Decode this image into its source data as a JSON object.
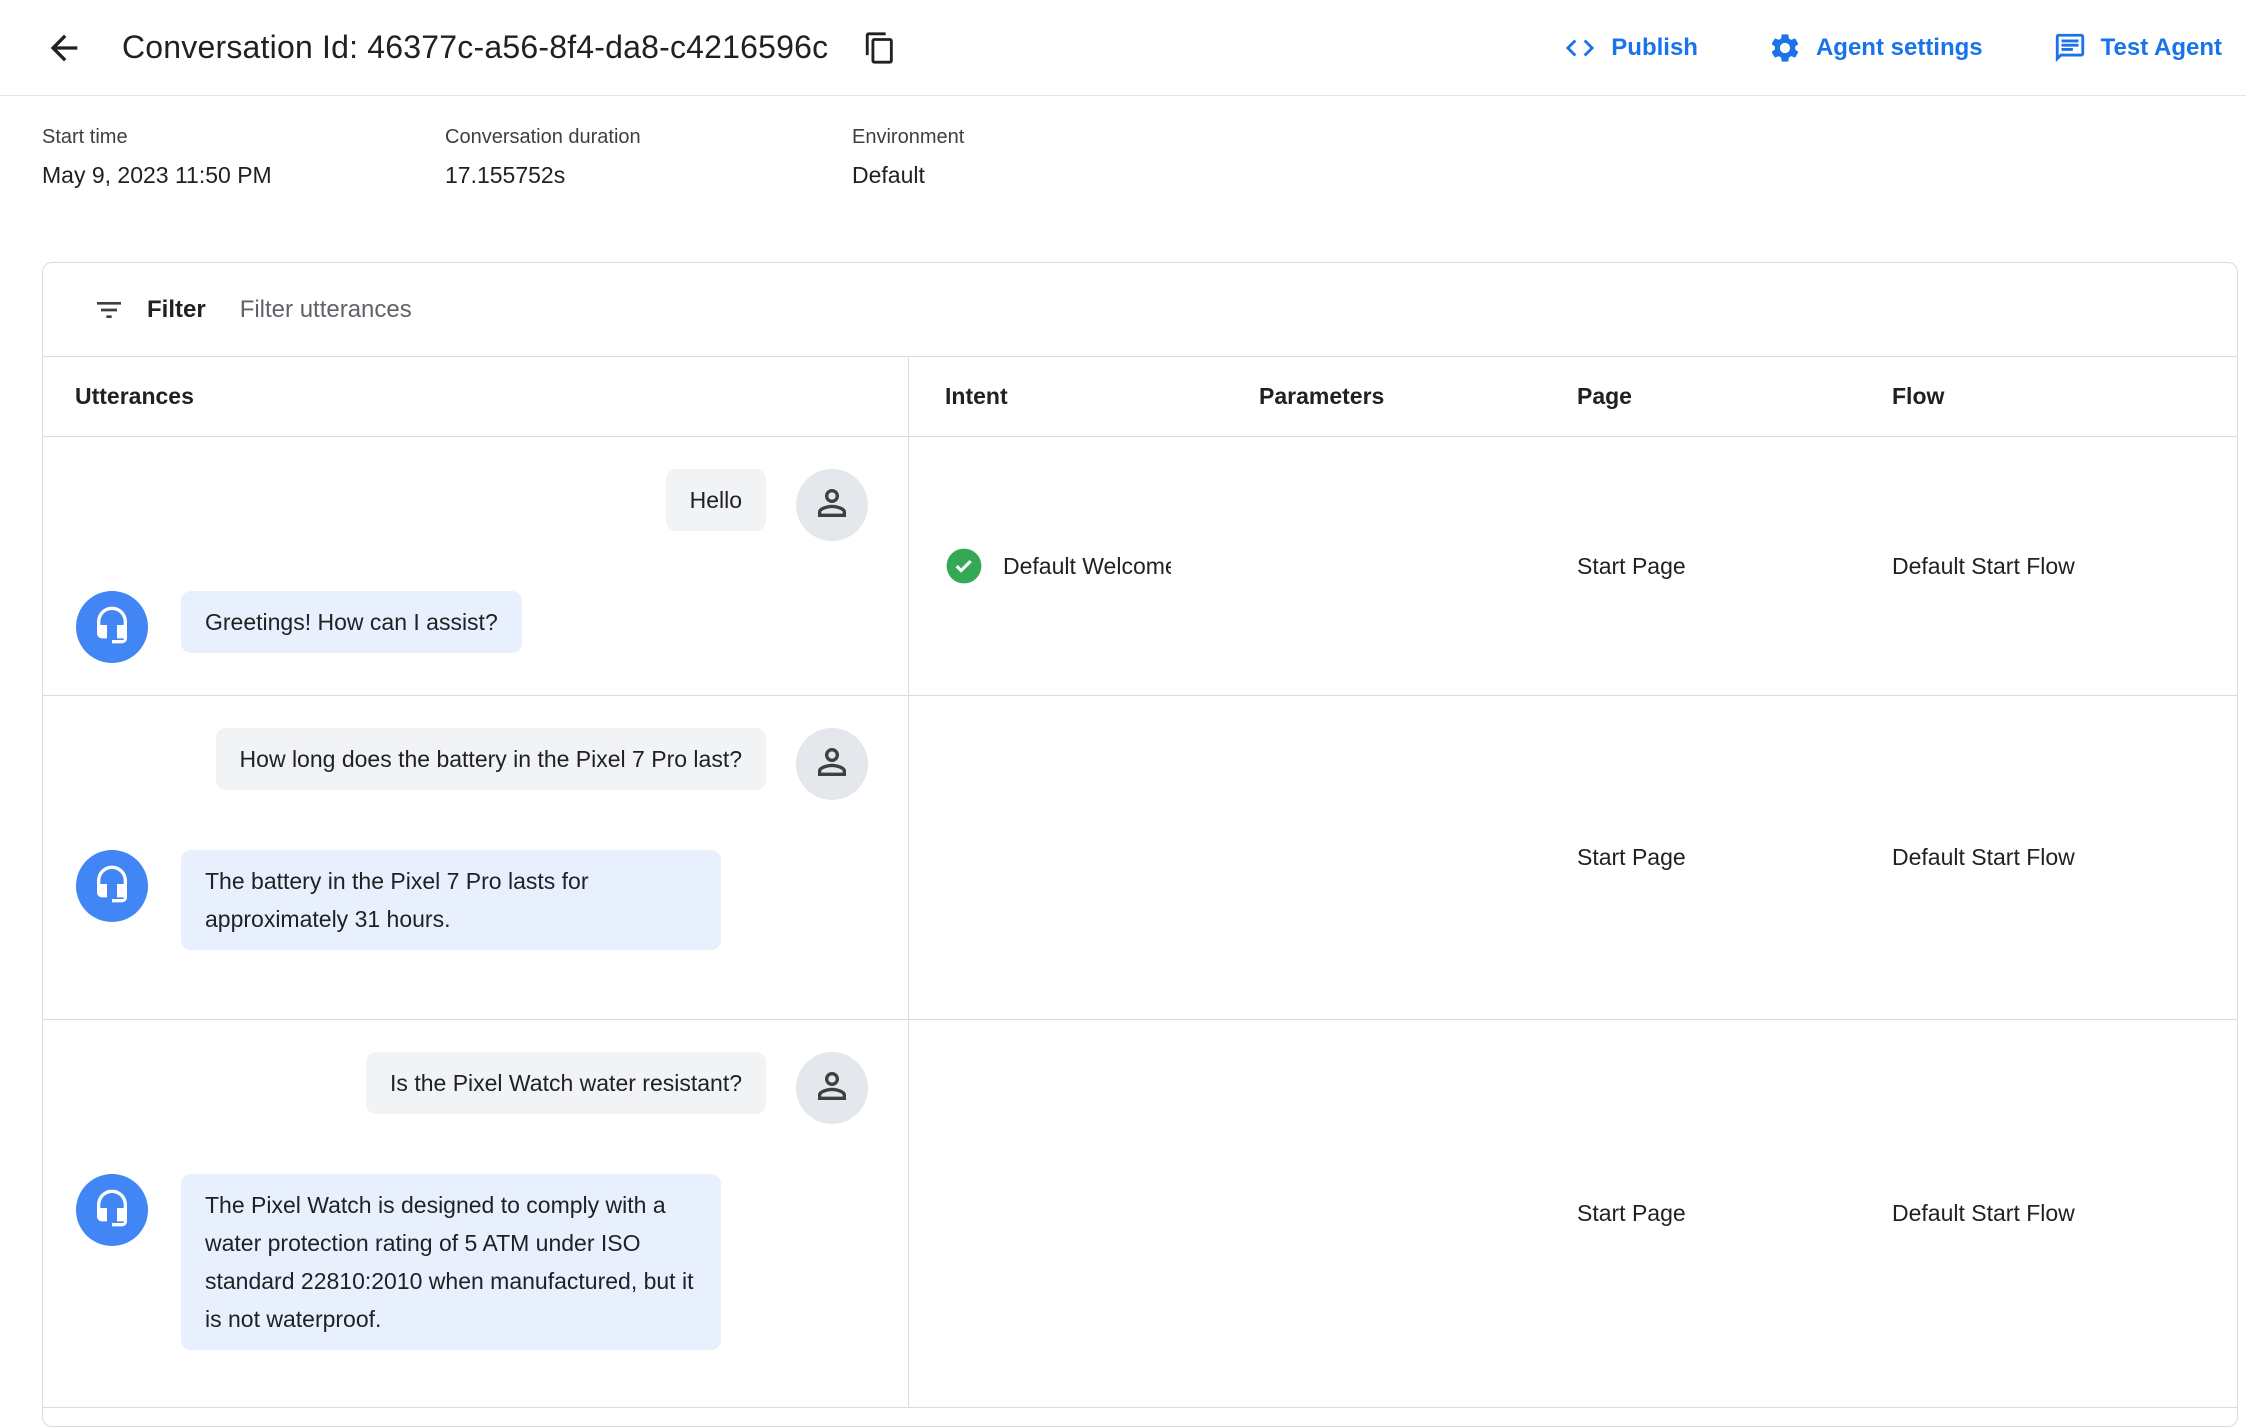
{
  "header": {
    "title": "Conversation Id: 46377c-a56-8f4-da8-c4216596c",
    "publish_label": "Publish",
    "agent_settings_label": "Agent settings",
    "test_agent_label": "Test Agent"
  },
  "meta": {
    "fields": [
      {
        "label": "Start time",
        "value": "May 9, 2023 11:50 PM"
      },
      {
        "label": "Conversation duration",
        "value": "17.155752s"
      },
      {
        "label": "Environment",
        "value": "Default"
      }
    ]
  },
  "filter": {
    "label": "Filter",
    "placeholder": "Filter utterances"
  },
  "table": {
    "columns": {
      "utterances": "Utterances",
      "intent": "Intent",
      "parameters": "Parameters",
      "page": "Page",
      "flow": "Flow"
    },
    "rows": [
      {
        "user": "Hello",
        "agent": "Greetings! How can I assist?",
        "intent": "Default Welcome",
        "parameters": "",
        "page": "Start Page",
        "flow": "Default Start Flow"
      },
      {
        "user": "How long does the battery in the Pixel 7 Pro last?",
        "agent": "The battery in the Pixel 7 Pro lasts for approximately 31 hours.",
        "intent": "",
        "parameters": "",
        "page": "Start Page",
        "flow": "Default Start Flow"
      },
      {
        "user": "Is the Pixel Watch water resistant?",
        "agent": "The Pixel Watch is designed to comply with a water protection rating of 5 ATM under ISO standard 22810:2010 when manufactured, but it is not waterproof.",
        "intent": "",
        "parameters": "",
        "page": "Start Page",
        "flow": "Default Start Flow"
      }
    ]
  },
  "icons": {
    "back": "arrow-back",
    "copy": "content-copy",
    "publish": "code-brackets",
    "agent_settings": "gear",
    "test_agent": "chat",
    "filter": "filter-list",
    "user": "person",
    "agent": "headset",
    "intent_matched": "check-circle"
  },
  "colors": {
    "accent": "#1a73e8",
    "green": "#34a853",
    "agent-avatar": "#4285f4",
    "agent-bubble": "#e8f0fe",
    "user-bubble": "#f1f3f4"
  }
}
